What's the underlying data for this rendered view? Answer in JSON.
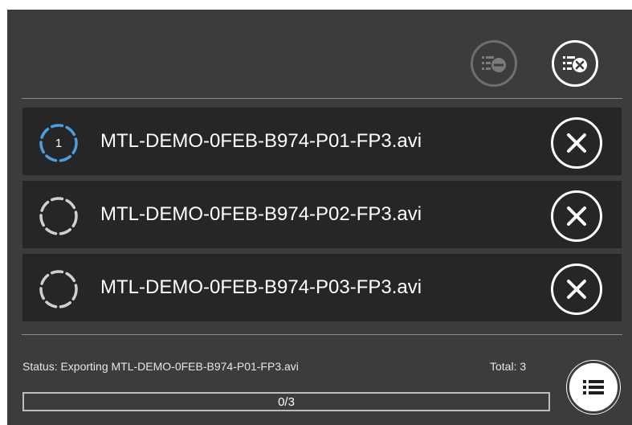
{
  "toolbar": {
    "remove_completed_icon": "list-remove-icon",
    "clear_all_icon": "list-clear-icon"
  },
  "queue": {
    "items": [
      {
        "name": "MTL-DEMO-0FEB-B974-P01-FP3.avi",
        "position": "1",
        "state": "active",
        "ring_color": "#4a9fe0"
      },
      {
        "name": "MTL-DEMO-0FEB-B974-P02-FP3.avi",
        "position": "",
        "state": "pending",
        "ring_color": "#d0d0d0"
      },
      {
        "name": "MTL-DEMO-0FEB-B974-P03-FP3.avi",
        "position": "",
        "state": "pending",
        "ring_color": "#d0d0d0"
      }
    ]
  },
  "footer": {
    "status": "Status: Exporting MTL-DEMO-0FEB-B974-P01-FP3.avi",
    "total": "Total: 3",
    "progress_label": "0/3",
    "progress_fraction": 0,
    "queue_icon": "list-icon"
  }
}
